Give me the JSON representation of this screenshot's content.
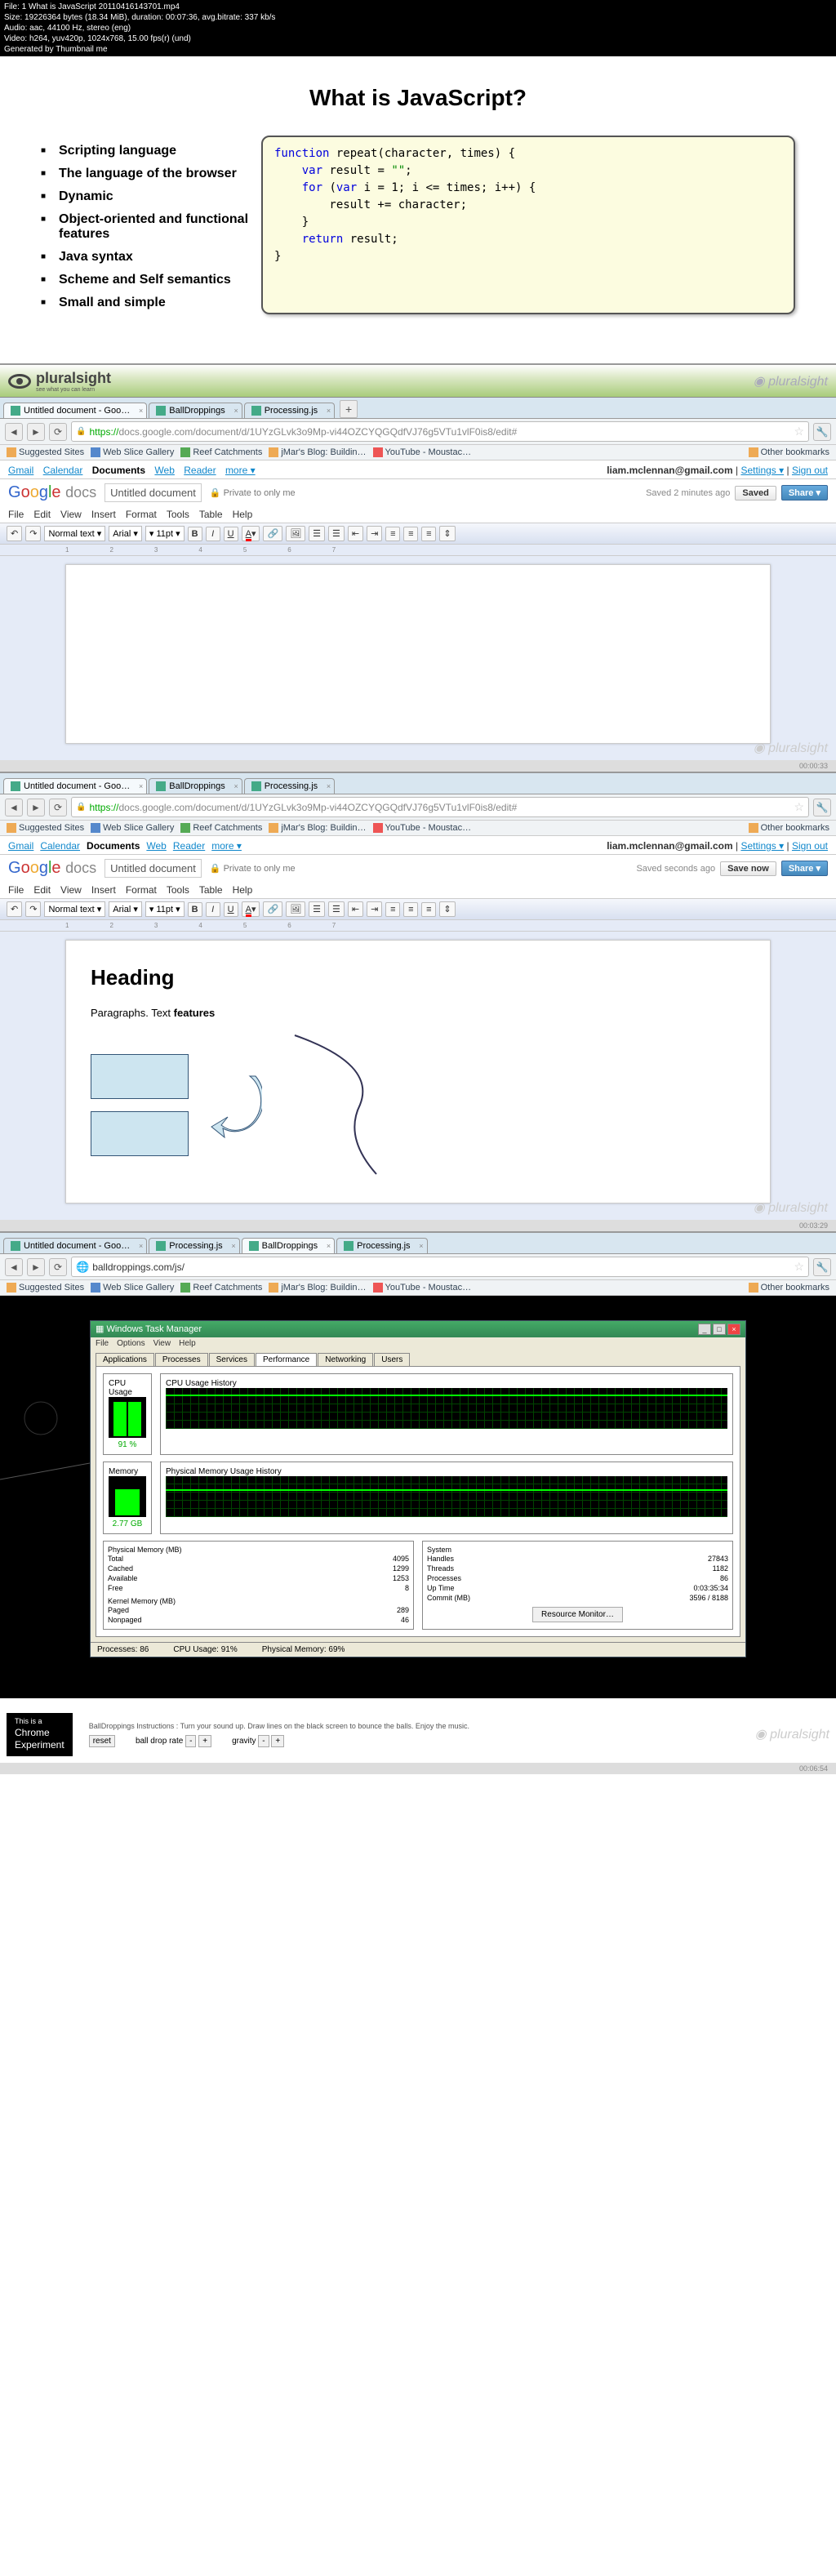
{
  "video_meta": {
    "file": "File: 1 What is JavaScript 20110416143701.mp4",
    "size": "Size: 19226364 bytes (18.34 MiB), duration: 00:07:36, avg.bitrate: 337 kb/s",
    "audio": "Audio: aac, 44100 Hz, stereo (eng)",
    "video": "Video: h264, yuv420p, 1024x768, 15.00 fps(r) (und)",
    "gen": "Generated by Thumbnail me"
  },
  "slide1": {
    "title": "What is JavaScript?",
    "bullets": [
      "Scripting language",
      "The language of the browser",
      "Dynamic",
      "Object-oriented and functional features",
      "Java syntax",
      "Scheme and Self semantics",
      "Small and simple"
    ]
  },
  "pluralsight": "pluralsight",
  "pluralsight_sub": "see what you can learn",
  "browser1": {
    "tabs": [
      "Untitled document - Goo…",
      "BallDroppings",
      "Processing.js"
    ],
    "url_proto": "https://",
    "url": "docs.google.com/document/d/1UYzGLvk3o9Mp-vi44OZCYQGQdfVJ76g5VTu1vlF0is8/edit#",
    "bookmarks": [
      "Suggested Sites",
      "Web Slice Gallery",
      "Reef Catchments",
      "jMar's Blog: Buildin…",
      "YouTube - Moustac…"
    ],
    "other_bm": "Other bookmarks"
  },
  "gdocs": {
    "nav": [
      "Gmail",
      "Calendar",
      "Documents",
      "Web",
      "Reader",
      "more ▾"
    ],
    "nav_cur": 2,
    "user": "liam.mclennan@gmail.com",
    "settings": "Settings ▾",
    "signout": "Sign out",
    "title": "Untitled document",
    "privacy": "Private to only me",
    "saved1": "Saved 2 minutes ago",
    "saved2": "Saved seconds ago",
    "btn_saved": "Saved",
    "btn_save": "Save now",
    "btn_share": "Share ▾",
    "menus": [
      "File",
      "Edit",
      "View",
      "Insert",
      "Format",
      "Tools",
      "Table",
      "Help"
    ],
    "style": "Normal text",
    "font": "Arial",
    "size": "11pt"
  },
  "doc2": {
    "heading": "Heading",
    "para": "Paragraphs. Text ",
    "para_b": "features"
  },
  "timestamps": {
    "s2": "00:00:33",
    "s3": "00:03:29",
    "s4": "00:06:54"
  },
  "browser3": {
    "tabs": [
      "Untitled document - Goo…",
      "Processing.js",
      "BallDroppings",
      "Processing.js"
    ],
    "active": 2,
    "url": "balldroppings.com/js/"
  },
  "taskmgr": {
    "title": "Windows Task Manager",
    "menus": [
      "File",
      "Options",
      "View",
      "Help"
    ],
    "tabs": [
      "Applications",
      "Processes",
      "Services",
      "Performance",
      "Networking",
      "Users"
    ],
    "cpu_lbl": "CPU Usage",
    "cpu_hist_lbl": "CPU Usage History",
    "cpu_pct": "91 %",
    "mem_lbl": "Memory",
    "mem_hist_lbl": "Physical Memory Usage History",
    "mem_val": "2.77 GB",
    "pm_title": "Physical Memory (MB)",
    "pm": [
      [
        "Total",
        "4095"
      ],
      [
        "Cached",
        "1299"
      ],
      [
        "Available",
        "1253"
      ],
      [
        "Free",
        "8"
      ]
    ],
    "km_title": "Kernel Memory (MB)",
    "km": [
      [
        "Paged",
        "289"
      ],
      [
        "Nonpaged",
        "46"
      ]
    ],
    "sys_title": "System",
    "sys": [
      [
        "Handles",
        "27843"
      ],
      [
        "Threads",
        "1182"
      ],
      [
        "Processes",
        "86"
      ],
      [
        "Up Time",
        "0:03:35:34"
      ],
      [
        "Commit (MB)",
        "3596 / 8188"
      ]
    ],
    "rm_btn": "Resource Monitor…",
    "status": [
      "Processes: 86",
      "CPU Usage: 91%",
      "Physical Memory: 69%"
    ]
  },
  "balldrop": {
    "inst": "BallDroppings Instructions : Turn your sound up. Draw lines on the black screen to bounce the balls. Enjoy the music.",
    "reset": "reset",
    "rate": "ball drop rate",
    "gravity": "gravity",
    "chrome1": "This is a",
    "chrome2": "Chrome",
    "chrome3": "Experiment"
  }
}
